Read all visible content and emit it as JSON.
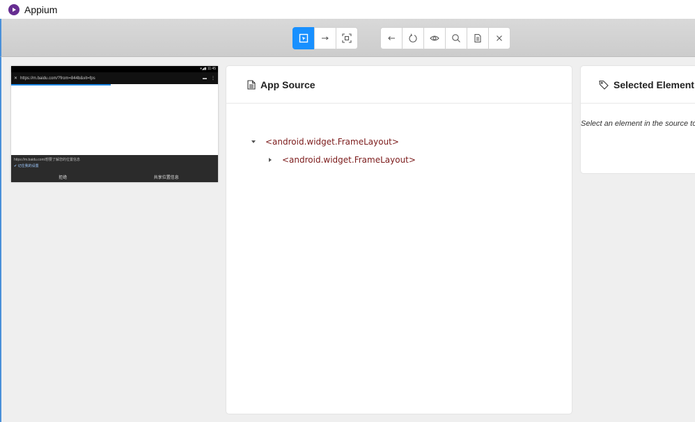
{
  "window": {
    "title": "Appium"
  },
  "toolbar": {
    "mode_buttons": [
      {
        "name": "select-elements-button",
        "icon": "select-element-icon",
        "active": true
      },
      {
        "name": "swipe-by-coordinates-button",
        "icon": "arrow-right-icon",
        "active": false
      },
      {
        "name": "tap-by-coordinates-button",
        "icon": "crosshair-icon",
        "active": false
      }
    ],
    "action_buttons": [
      {
        "name": "back-button",
        "icon": "arrow-left-icon"
      },
      {
        "name": "refresh-button",
        "icon": "refresh-icon"
      },
      {
        "name": "start-recording-button",
        "icon": "eye-icon"
      },
      {
        "name": "search-elements-button",
        "icon": "search-icon"
      },
      {
        "name": "copy-xml-button",
        "icon": "copy-icon"
      },
      {
        "name": "quit-session-button",
        "icon": "close-icon"
      }
    ],
    "accent_color": "#1890ff"
  },
  "device": {
    "status": "▾◢▮ 11:45",
    "url": "https://m.baidu.com/?from=844b&vit=fps",
    "sheet_message": "https://m.baidu.com/想要了解您的位置信息",
    "remember_label": "记住我的设置",
    "deny_label": "拒绝",
    "allow_label": "共享位置信息"
  },
  "app_source": {
    "title": "App Source",
    "tree": [
      {
        "label": "<android.widget.FrameLayout>",
        "expanded": true
      },
      {
        "label": "<android.widget.FrameLayout>",
        "expanded": false
      }
    ]
  },
  "selected_element": {
    "title": "Selected Element",
    "hint": "Select an element in the source to begin."
  }
}
